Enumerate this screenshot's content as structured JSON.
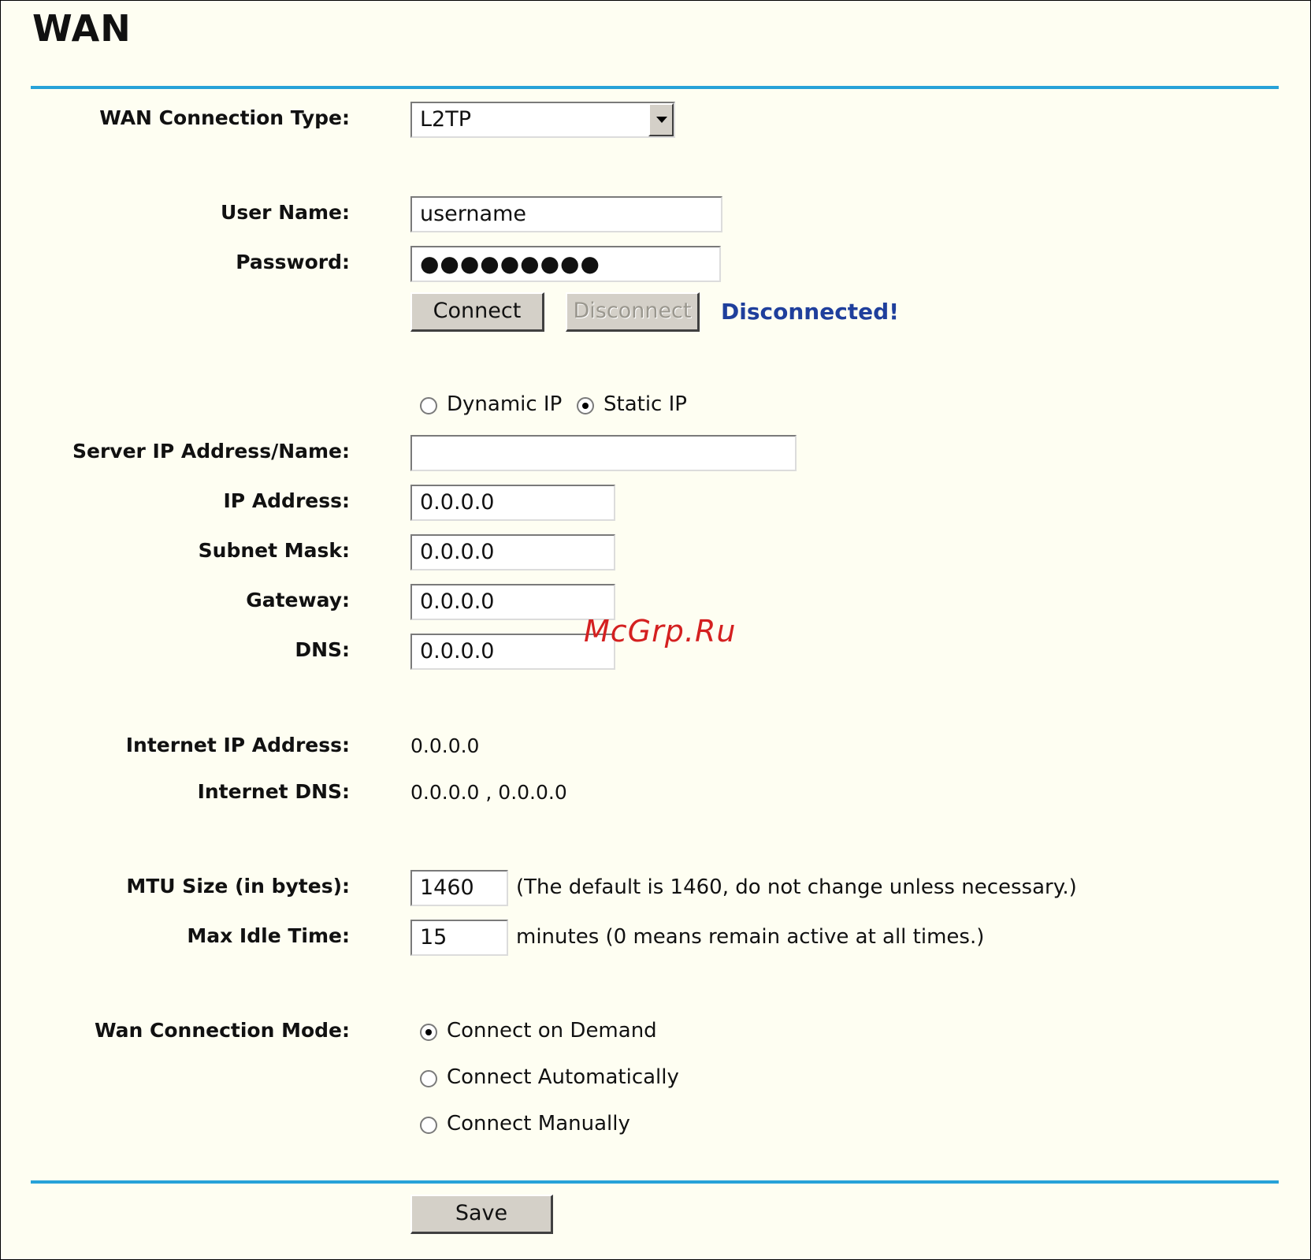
{
  "page": {
    "title": "WAN"
  },
  "colors": {
    "rule": "#27a2d8",
    "status": "#1f3f9c",
    "background": "#fefef2",
    "watermark": "#d42020"
  },
  "labels": {
    "connection_type": "WAN Connection Type:",
    "user_name": "User Name:",
    "password": "Password:",
    "server_ip": "Server IP Address/Name:",
    "ip_address": "IP Address:",
    "subnet_mask": "Subnet Mask:",
    "gateway": "Gateway:",
    "dns": "DNS:",
    "internet_ip": "Internet IP Address:",
    "internet_dns": "Internet DNS:",
    "mtu": "MTU Size (in bytes):",
    "max_idle": "Max Idle Time:",
    "connection_mode": "Wan Connection Mode:"
  },
  "fields": {
    "connection_type": "L2TP",
    "user_name": "username",
    "password": "●●●●●●●●●",
    "server_ip": "",
    "ip_address": "0.0.0.0",
    "subnet_mask": "0.0.0.0",
    "gateway": "0.0.0.0",
    "dns": "0.0.0.0",
    "mtu": "1460",
    "max_idle": "15"
  },
  "buttons": {
    "connect": "Connect",
    "disconnect": "Disconnect",
    "save": "Save"
  },
  "status": {
    "text": "Disconnected!"
  },
  "ip_mode": {
    "dynamic": "Dynamic IP",
    "static": "Static IP",
    "selected": "static"
  },
  "internet": {
    "ip": "0.0.0.0",
    "dns": "0.0.0.0 , 0.0.0.0"
  },
  "notes": {
    "mtu": "(The default is 1460, do not change unless necessary.)",
    "max_idle": "minutes (0 means remain active at all times.)"
  },
  "connection_mode": {
    "on_demand": "Connect on Demand",
    "automatically": "Connect Automatically",
    "manually": "Connect Manually",
    "selected": "on_demand"
  },
  "watermark": "McGrp.Ru"
}
